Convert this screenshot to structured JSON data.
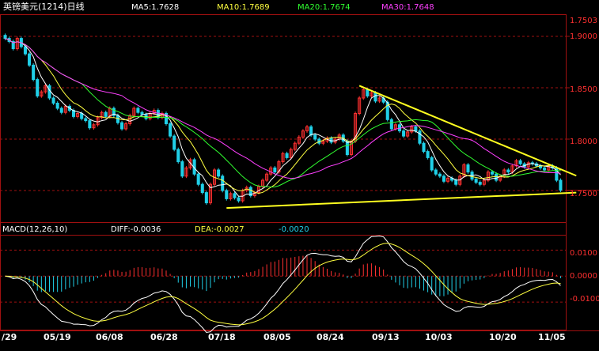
{
  "header": {
    "instrument": "英镑美元(1214)日线",
    "ma5": "MA5:1.7628",
    "ma10": "MA10:1.7689",
    "ma20": "MA20:1.7674",
    "ma30": "MA30:1.7648",
    "last_price": "1.7503"
  },
  "macd_header": {
    "name": "MACD(12,26,10)",
    "diff": "DIFF:-0.0036",
    "dea": "DEA:-0.0027",
    "macd": "-0.0020"
  },
  "colors": {
    "up": "#ff3030",
    "down": "#20d0e8",
    "ma5": "#ffffff",
    "ma10": "#ffff40",
    "ma20": "#30ff30",
    "ma30": "#ff40ff",
    "trend": "#ffff20",
    "grid": "#a01010"
  },
  "chart_data": {
    "type": "candlestick",
    "instrument": "英镑美元(1214)日线",
    "price_axis": {
      "ticks": [
        "1.9000",
        "1.8500",
        "1.8000",
        "1.7500"
      ],
      "range": [
        1.72,
        1.92
      ]
    },
    "macd_axis": {
      "ticks": [
        "0.0100",
        "0.0000",
        "-0.0100"
      ],
      "range": [
        -0.02,
        0.015
      ]
    },
    "x_ticks": [
      "/29",
      "05/19",
      "06/08",
      "06/28",
      "07/18",
      "08/05",
      "08/24",
      "09/13",
      "10/03",
      "10/20",
      "11/05"
    ],
    "closes": [
      1.898,
      1.895,
      1.888,
      1.898,
      1.89,
      1.883,
      1.872,
      1.858,
      1.842,
      1.846,
      1.852,
      1.84,
      1.835,
      1.83,
      1.826,
      1.832,
      1.828,
      1.822,
      1.825,
      1.82,
      1.818,
      1.811,
      1.814,
      1.821,
      1.826,
      1.822,
      1.83,
      1.823,
      1.816,
      1.81,
      1.815,
      1.823,
      1.83,
      1.826,
      1.824,
      1.82,
      1.825,
      1.828,
      1.821,
      1.825,
      1.815,
      1.803,
      1.79,
      1.778,
      1.764,
      1.772,
      1.78,
      1.766,
      1.756,
      1.748,
      1.738,
      1.756,
      1.77,
      1.764,
      1.75,
      1.742,
      1.747,
      1.743,
      1.74,
      1.75,
      1.753,
      1.745,
      1.748,
      1.754,
      1.76,
      1.766,
      1.772,
      1.768,
      1.778,
      1.786,
      1.782,
      1.79,
      1.796,
      1.802,
      1.808,
      1.812,
      1.804,
      1.8,
      1.796,
      1.798,
      1.801,
      1.797,
      1.8,
      1.804,
      1.798,
      1.785,
      1.798,
      1.825,
      1.84,
      1.848,
      1.842,
      1.845,
      1.837,
      1.84,
      1.836,
      1.819,
      1.81,
      1.814,
      1.808,
      1.803,
      1.807,
      1.812,
      1.808,
      1.796,
      1.788,
      1.782,
      1.77,
      1.766,
      1.764,
      1.759,
      1.762,
      1.76,
      1.756,
      1.764,
      1.775,
      1.768,
      1.761,
      1.758,
      1.756,
      1.76,
      1.768,
      1.766,
      1.76,
      1.764,
      1.77,
      1.768,
      1.774,
      1.779,
      1.776,
      1.773,
      1.777,
      1.776,
      1.774,
      1.772,
      1.77,
      1.774,
      1.772,
      1.76,
      1.7503
    ],
    "volumes_note": "",
    "trendlines": [
      {
        "from": [
          88,
          1.852
        ],
        "to": [
          136,
          1.774
        ]
      },
      {
        "from": [
          55,
          1.733
        ],
        "to": [
          136,
          1.747
        ]
      }
    ]
  }
}
